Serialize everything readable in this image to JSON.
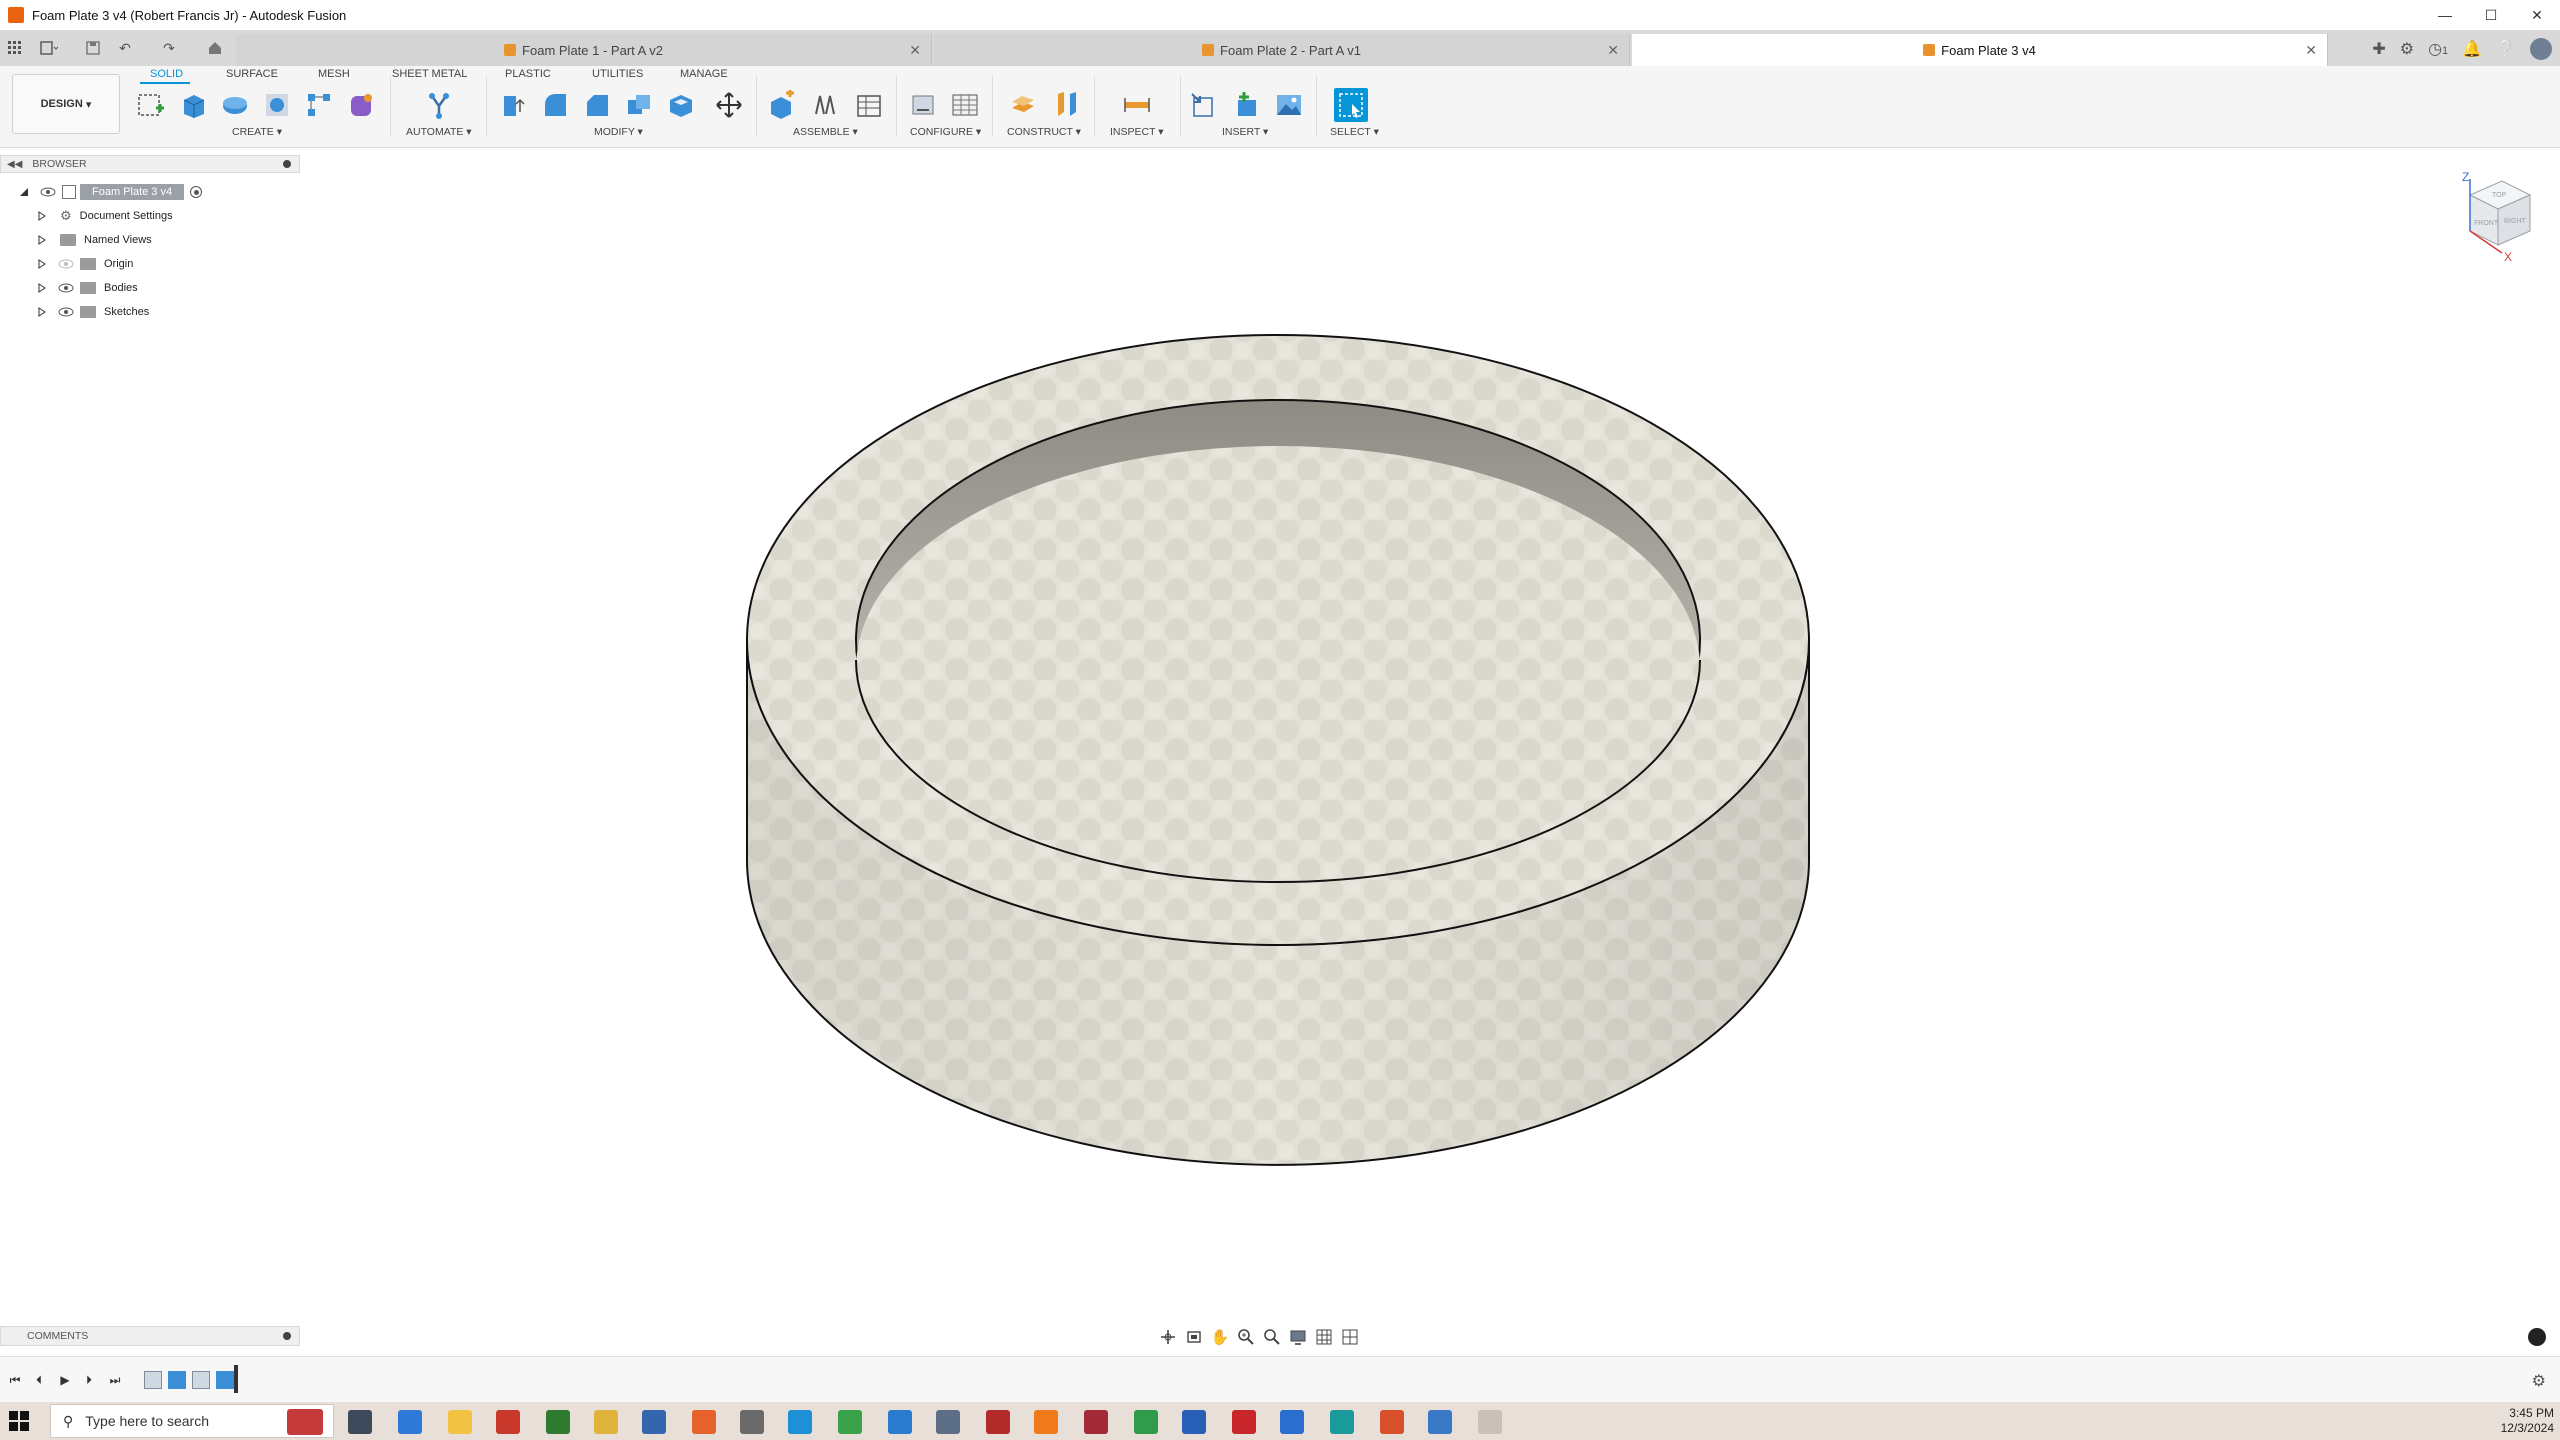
{
  "window": {
    "title": "Foam Plate 3 v4 (Robert Francis Jr) - Autodesk Fusion"
  },
  "tabs": [
    {
      "label": "Foam Plate 1 - Part A v2",
      "active": false
    },
    {
      "label": "Foam Plate 2 - Part A v1",
      "active": false
    },
    {
      "label": "Foam Plate 3 v4",
      "active": true
    }
  ],
  "tab_right": {
    "job_count": "1"
  },
  "toolbar": {
    "workspace": "DESIGN",
    "workspace_tabs": [
      "SOLID",
      "SURFACE",
      "MESH",
      "SHEET METAL",
      "PLASTIC",
      "UTILITIES",
      "MANAGE"
    ],
    "active_tab": "SOLID",
    "groups": [
      "CREATE ▾",
      "AUTOMATE ▾",
      "MODIFY ▾",
      "ASSEMBLE ▾",
      "CONFIGURE ▾",
      "CONSTRUCT ▾",
      "INSPECT ▾",
      "INSERT ▾",
      "SELECT ▾"
    ]
  },
  "browser": {
    "header": "BROWSER",
    "root": "Foam Plate 3 v4",
    "items": [
      "Document Settings",
      "Named Views",
      "Origin",
      "Bodies",
      "Sketches"
    ]
  },
  "viewcube": {
    "top": "TOP",
    "front": "FRONT",
    "right": "RIGHT",
    "axis_z": "Z",
    "axis_x": "X"
  },
  "comments": {
    "header": "COMMENTS"
  },
  "taskbar": {
    "search_placeholder": "Type here to search",
    "time": "3:45 PM",
    "date": "12/3/2024"
  },
  "colors": {
    "accent": "#0696d7",
    "foam": "#e4e1d8",
    "active_tab": "#ffffff"
  }
}
